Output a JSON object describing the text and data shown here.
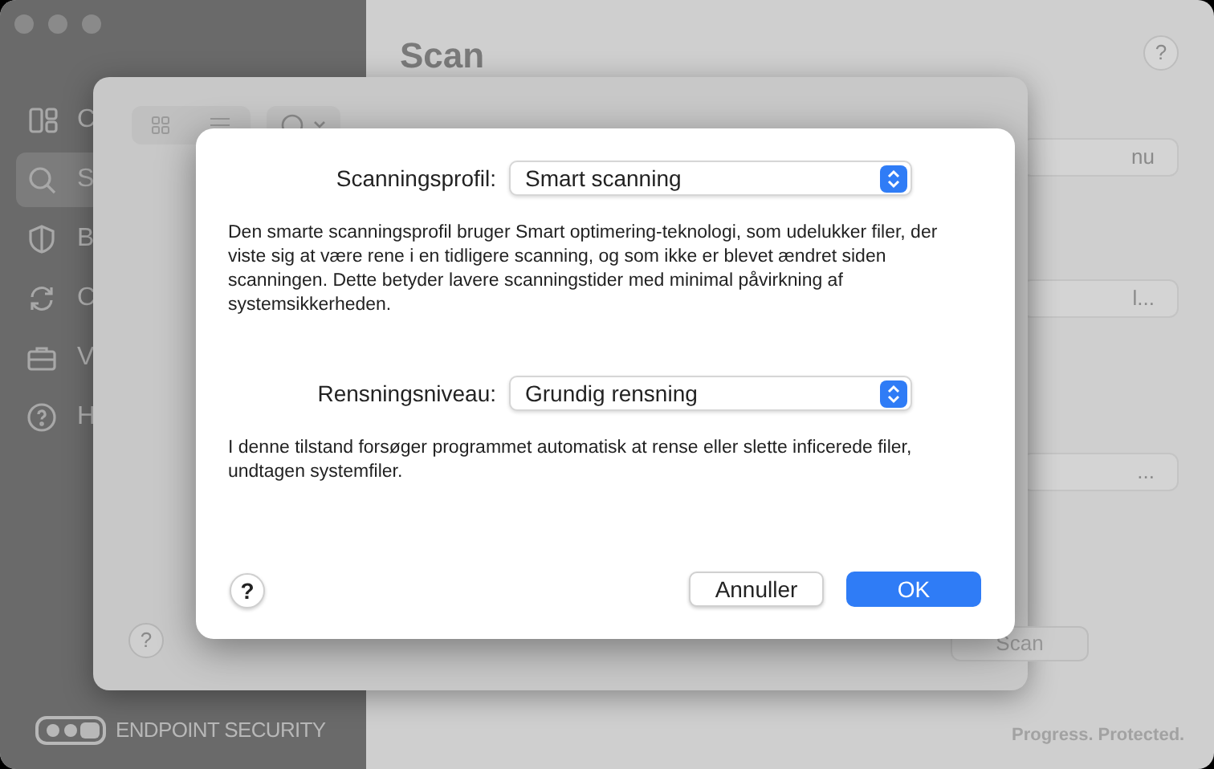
{
  "window": {
    "title": "Scan",
    "help": "?"
  },
  "sidebar": {
    "items": [
      {
        "label": "C",
        "selected": false
      },
      {
        "label": "S",
        "selected": true
      },
      {
        "label": "B",
        "selected": false
      },
      {
        "label": "C",
        "selected": false
      },
      {
        "label": "V",
        "selected": false
      },
      {
        "label": "H",
        "selected": false
      }
    ],
    "brand": "ENDPOINT SECURITY"
  },
  "background_buttons": [
    "nu",
    "l...",
    "..."
  ],
  "tagline": "Progress. Protected.",
  "sheet": {
    "help": "?",
    "buttons": [
      {
        "label": "Scan"
      }
    ]
  },
  "dialog": {
    "fields": [
      {
        "label": "Scanningsprofil:",
        "value": "Smart scanning",
        "description": "Den smarte scanningsprofil bruger Smart optimering-teknologi, som udelukker filer, der viste sig at være rene i en tidligere scanning, og som ikke er blevet ændret siden scanningen. Dette betyder lavere scanningstider med minimal påvirkning af systemsikkerheden."
      },
      {
        "label": "Rensningsniveau:",
        "value": "Grundig rensning",
        "description": "I denne tilstand forsøger programmet automatisk at rense eller slette inficerede filer, undtagen systemfiler."
      }
    ],
    "help": "?",
    "buttons": [
      {
        "label": "Annuller",
        "kind": "secondary"
      },
      {
        "label": "OK",
        "kind": "primary"
      }
    ]
  }
}
